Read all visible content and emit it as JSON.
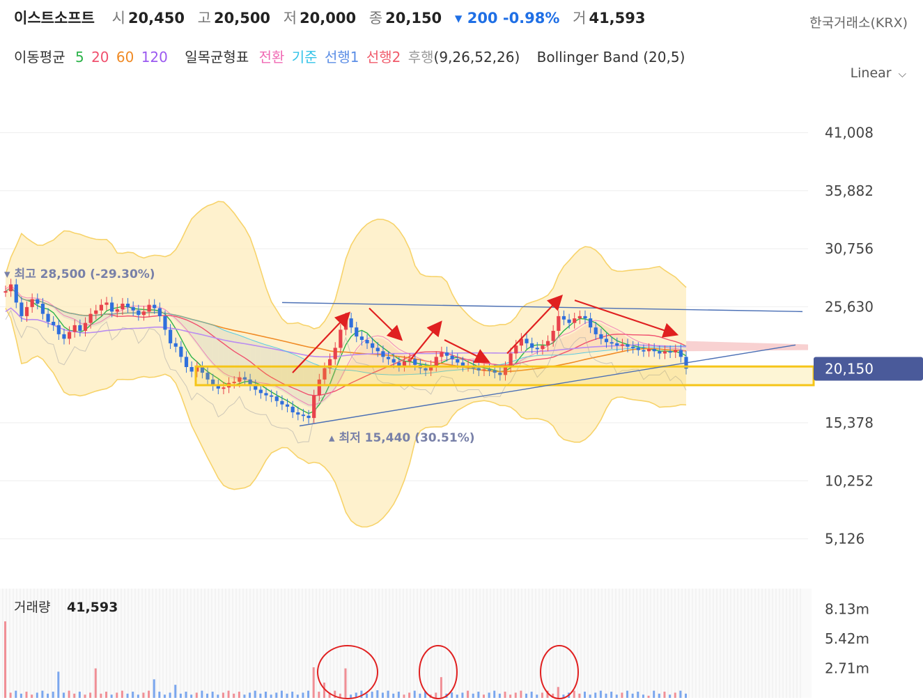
{
  "header": {
    "name": "이스트소프트",
    "open_label": "시",
    "open": "20,450",
    "high_label": "고",
    "high": "20,500",
    "low_label": "저",
    "low": "20,000",
    "close_label": "종",
    "close": "20,150",
    "change": "▾ 200 -0.98%",
    "volume_label": "거",
    "volume": "41,593",
    "exchange": "한국거래소(KRX)"
  },
  "indicators": {
    "ma_label": "이동평균",
    "ma_periods": [
      {
        "label": "5",
        "color": "#2db34a"
      },
      {
        "label": "20",
        "color": "#f0506e"
      },
      {
        "label": "60",
        "color": "#f08a24"
      },
      {
        "label": "120",
        "color": "#9b59f0"
      }
    ],
    "ichimoku_label": "일목균형표",
    "ichimoku_lines": [
      {
        "label": "전환",
        "color": "#f06ab4"
      },
      {
        "label": "기준",
        "color": "#33c3e8"
      },
      {
        "label": "선행1",
        "color": "#5b8ee6"
      },
      {
        "label": "선행2",
        "color": "#f05a6a"
      },
      {
        "label": "후행",
        "color": "#999999"
      }
    ],
    "ichimoku_params": "(9,26,52,26)",
    "bollinger": "Bollinger Band (20,5)"
  },
  "scale_mode": "Linear",
  "colors": {
    "up": "#e8424b",
    "down": "#2f6fdc",
    "bollinger_fill": "#fdebb8",
    "bollinger_line": "#f7d36a",
    "cloud_red": "#f4b3b3",
    "cloud_blue": "#a8c8e8",
    "highlight": "#f5c518",
    "price_tag": "#4a5a9a",
    "annotation": "#e02020",
    "trendline": "#4a6fb5"
  },
  "chart_data": {
    "type": "candlestick",
    "y_axis_ticks": [
      "41,008",
      "35,882",
      "30,756",
      "25,630",
      "20,150",
      "15,378",
      "10,252",
      "5,126"
    ],
    "y_range": [
      3500,
      43500
    ],
    "current_price": 20150,
    "current_price_label": "20,150",
    "max_marker": "▾ 최고 28,500 (-29.30%)",
    "max_value": 28500,
    "min_marker": "▴ 최저 15,440 (30.51%)",
    "min_value": 15440,
    "highlight_zone": [
      18700,
      20350
    ],
    "close": [
      27000,
      27600,
      26000,
      24800,
      25600,
      26300,
      25900,
      25000,
      24300,
      24000,
      23200,
      22800,
      23400,
      24000,
      23500,
      24200,
      25000,
      25300,
      25800,
      26000,
      25200,
      25400,
      25900,
      25600,
      25300,
      24900,
      25200,
      25800,
      25500,
      24800,
      23600,
      22400,
      22100,
      21200,
      20300,
      19900,
      20300,
      19800,
      19200,
      18700,
      18400,
      18500,
      18900,
      19000,
      19400,
      19200,
      18700,
      18300,
      18000,
      17800,
      17700,
      17300,
      17000,
      16800,
      16300,
      16100,
      16000,
      15800,
      17800,
      19200,
      20200,
      21000,
      22000,
      23600,
      24600,
      23800,
      23000,
      22700,
      22400,
      22000,
      21700,
      21200,
      21000,
      20700,
      20400,
      20800,
      21000,
      20500,
      20200,
      20000,
      20400,
      21200,
      21600,
      21300,
      21000,
      20700,
      20400,
      20400,
      20200,
      20000,
      20100,
      20000,
      19800,
      19600,
      20300,
      21500,
      22200,
      22800,
      22400,
      22000,
      21900,
      22200,
      22600,
      23500,
      24800,
      24500,
      24200,
      24600,
      24800,
      24600,
      23800,
      23200,
      22800,
      22500,
      22400,
      22200,
      22300,
      22100,
      22000,
      21800,
      21700,
      21900,
      21700,
      21500,
      21700,
      21600,
      21800,
      21200,
      20150
    ],
    "volume_label": "거래량",
    "volume_value": "41,593",
    "volume_ticks": [
      "8.13m",
      "5.42m",
      "2.71m"
    ],
    "volume_range": [
      0,
      10000000
    ],
    "volume_spikes": [
      {
        "index": 0,
        "value": 7000000
      },
      {
        "index": 10,
        "value": 2400000
      },
      {
        "index": 17,
        "value": 2700000
      },
      {
        "index": 28,
        "value": 1700000
      },
      {
        "index": 32,
        "value": 1200000
      },
      {
        "index": 58,
        "value": 2800000
      },
      {
        "index": 60,
        "value": 1400000
      },
      {
        "index": 64,
        "value": 2700000
      },
      {
        "index": 70,
        "value": 700000
      },
      {
        "index": 82,
        "value": 1900000
      },
      {
        "index": 84,
        "value": 500000
      },
      {
        "index": 104,
        "value": 1000000
      },
      {
        "index": 110,
        "value": 300000
      },
      {
        "index": 121,
        "value": 200000
      }
    ]
  }
}
